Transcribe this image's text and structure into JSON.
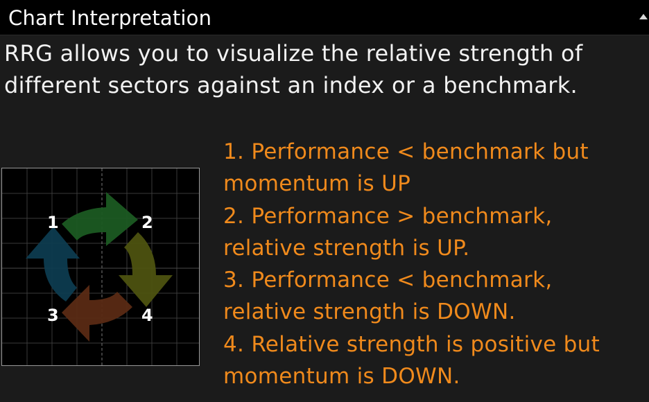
{
  "panel": {
    "title": "Chart Interpretation",
    "description_lines": [
      "RRG allows you to visualize the relative strength of",
      "different sectors against an index or a benchmark."
    ]
  },
  "diagram": {
    "quadrant_labels": [
      "1",
      "2",
      "3",
      "4"
    ],
    "arrow_colors": {
      "arrow_1": "#0d3b4f",
      "arrow_2": "#1b5a22",
      "arrow_3": "#5a2a14",
      "arrow_4": "#4d5210"
    },
    "grid_color": "#3a3a3a"
  },
  "legend": {
    "color": "#f08a1c",
    "lines": [
      "1. Performance < benchmark but",
      "momentum is UP",
      "2. Performance > benchmark,",
      "relative strength is UP.",
      "3. Performance < benchmark,",
      "relative strength is DOWN.",
      "4. Relative strength is positive but",
      "momentum is DOWN."
    ]
  }
}
